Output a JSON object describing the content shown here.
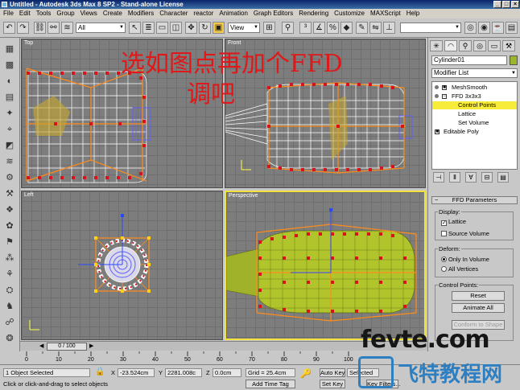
{
  "window": {
    "title": "Untitled - Autodesk 3ds Max 8 SP2 - Stand-alone License"
  },
  "menu": [
    "File",
    "Edit",
    "Tools",
    "Group",
    "Views",
    "Create",
    "Modifiers",
    "Character",
    "reactor",
    "Animation",
    "Graph Editors",
    "Rendering",
    "Customize",
    "MAXScript",
    "Help"
  ],
  "toolbar": {
    "selection_filter": "All",
    "ref_coord": "View"
  },
  "viewports": {
    "top": "Top",
    "front": "Front",
    "left": "Left",
    "perspective": "Perspective"
  },
  "annotation": {
    "line1": "选如图点再加个FFD",
    "line2": "调吧"
  },
  "command_panel": {
    "object_name": "Cylinder01",
    "object_color": "#9ab62a",
    "modifier_list": "Modifier List",
    "stack": [
      {
        "label": "MeshSmooth",
        "selected": false
      },
      {
        "label": "FFD 3x3x3",
        "selected": false
      },
      {
        "label": "Control Points",
        "selected": true
      },
      {
        "label": "Lattice",
        "selected": false
      },
      {
        "label": "Set Volume",
        "selected": false
      },
      {
        "label": "Editable Poly",
        "selected": false
      }
    ],
    "ffd_params": {
      "header": "FFD Parameters",
      "display_title": "Display:",
      "lattice": "Lattice",
      "lattice_checked": true,
      "source_volume": "Source Volume",
      "source_volume_checked": false,
      "deform_title": "Deform:",
      "only_in_volume": "Only In Volume",
      "all_vertices": "All Vertices",
      "deform_mode": "Only In Volume",
      "control_points_title": "Control Points:",
      "reset": "Reset",
      "animate_all": "Animate All",
      "conform": "Conform to Shape"
    }
  },
  "timeline": {
    "frame_display": "0 / 100",
    "ticks": [
      "0",
      "10",
      "20",
      "30",
      "40",
      "50",
      "60",
      "70",
      "80",
      "90",
      "100"
    ]
  },
  "status": {
    "selection": "1 Object Selected",
    "prompt": "Click or click-and-drag to select objects",
    "x_label": "X",
    "x": "-23.524cm",
    "y_label": "Y",
    "y": "2281.008c",
    "z_label": "Z",
    "z": "0.0cm",
    "grid": "Grid = 25.4cm",
    "add_time_tag": "Add Time Tag",
    "auto_key": "Auto Key",
    "set_key": "Set Key",
    "selected": "Selected",
    "key_filters": "Key Filters..."
  },
  "watermark": {
    "brand": "fevte.com",
    "cn": "飞特教程网"
  }
}
